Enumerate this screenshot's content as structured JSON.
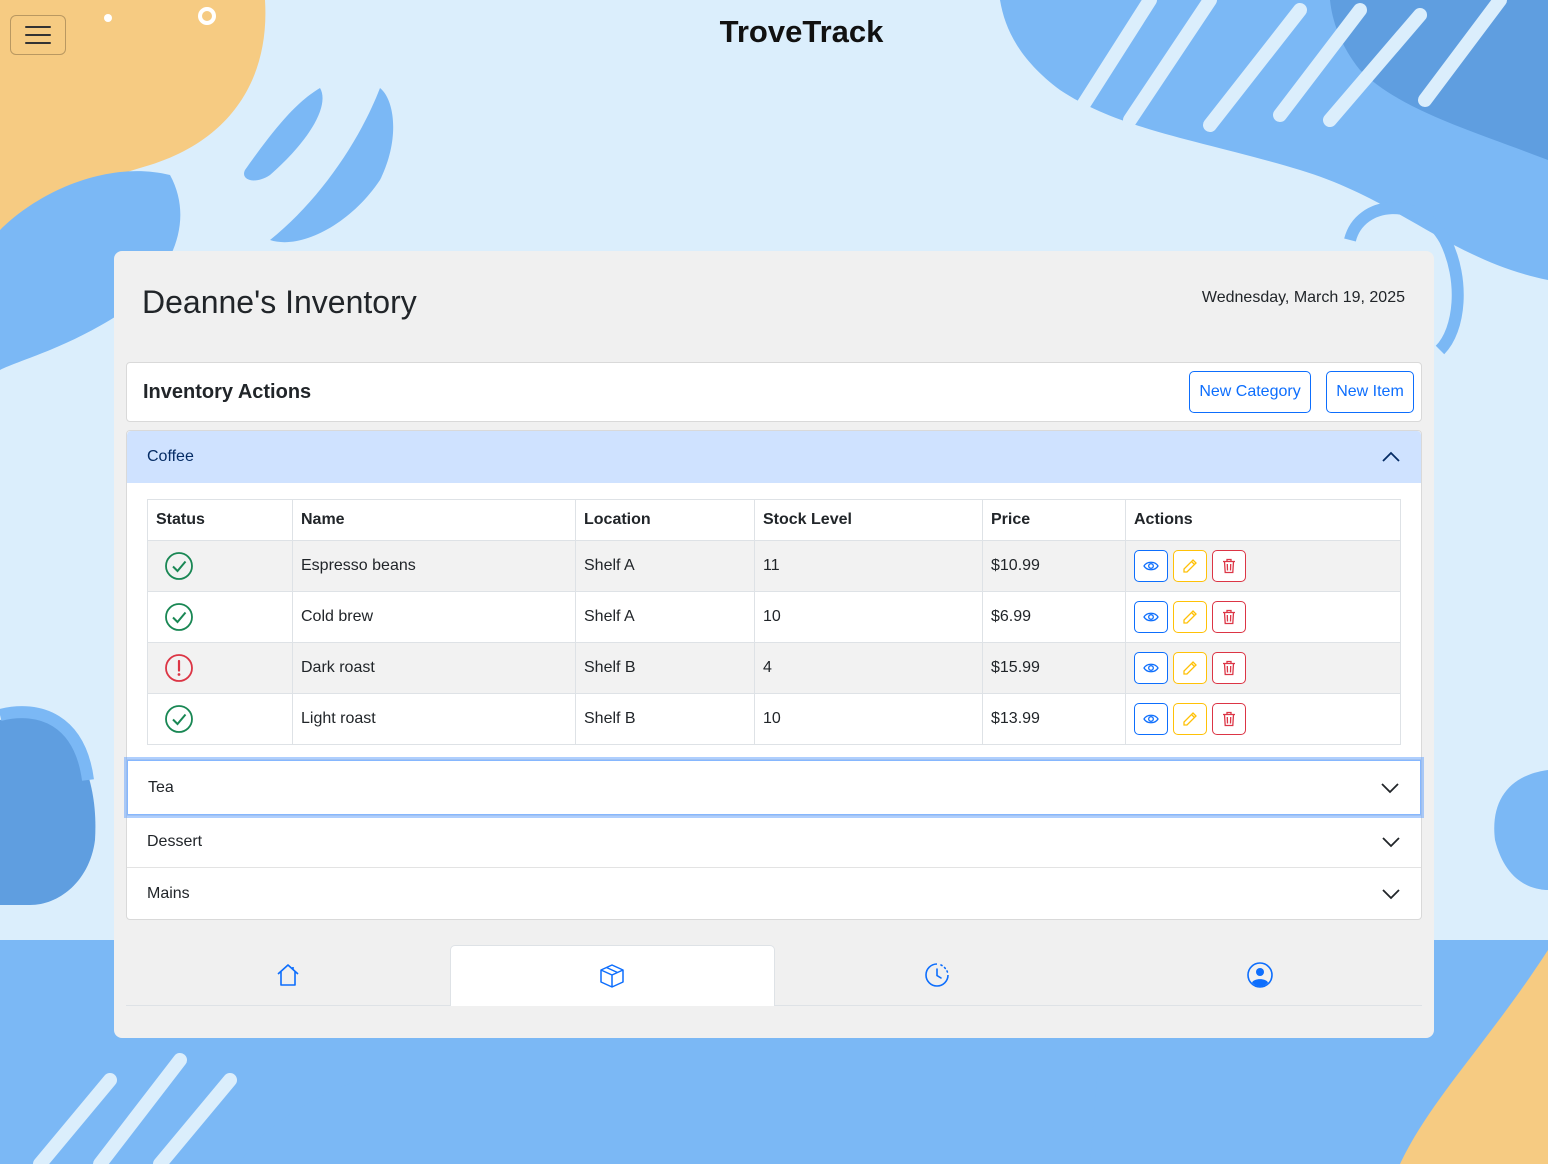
{
  "app": {
    "title": "TroveTrack"
  },
  "page": {
    "title": "Deanne's Inventory",
    "date": "Wednesday, March 19, 2025"
  },
  "actions": {
    "title": "Inventory Actions",
    "new_category": "New Category",
    "new_item": "New Item"
  },
  "categories": [
    {
      "name": "Coffee",
      "expanded": true
    },
    {
      "name": "Tea",
      "expanded": false
    },
    {
      "name": "Dessert",
      "expanded": false
    },
    {
      "name": "Mains",
      "expanded": false
    }
  ],
  "table": {
    "headers": [
      "Status",
      "Name",
      "Location",
      "Stock Level",
      "Price",
      "Actions"
    ],
    "rows": [
      {
        "status": "ok",
        "name": "Espresso beans",
        "location": "Shelf A",
        "stock": "11",
        "price": "$10.99"
      },
      {
        "status": "ok",
        "name": "Cold brew",
        "location": "Shelf A",
        "stock": "10",
        "price": "$6.99"
      },
      {
        "status": "low",
        "name": "Dark roast",
        "location": "Shelf B",
        "stock": "4",
        "price": "$15.99"
      },
      {
        "status": "ok",
        "name": "Light roast",
        "location": "Shelf B",
        "stock": "10",
        "price": "$13.99"
      }
    ]
  },
  "tabs": [
    {
      "icon": "house-icon",
      "active": false
    },
    {
      "icon": "box-icon",
      "active": true
    },
    {
      "icon": "clock-history-icon",
      "active": false
    },
    {
      "icon": "person-circle-icon",
      "active": false
    }
  ],
  "colors": {
    "primary": "#0d6efd",
    "warning": "#ffc107",
    "danger": "#dc3545",
    "success": "#198754",
    "accordion_active": "#cfe2ff",
    "background": "#dbeefc"
  }
}
